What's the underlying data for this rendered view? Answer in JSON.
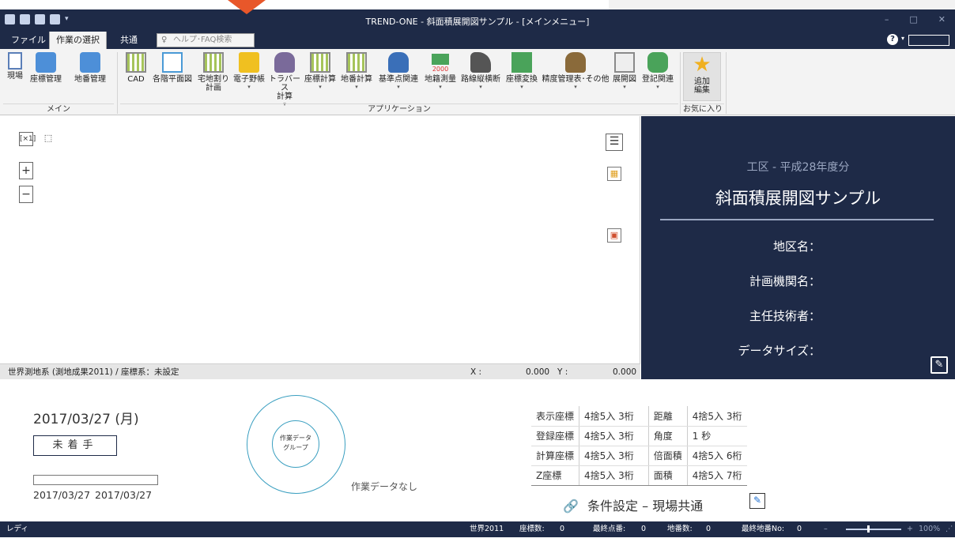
{
  "window": {
    "title": "TREND-ONE - 斜面積展開図サンプル - [メインメニュー]",
    "controls": [
      "–",
      "□",
      "✕"
    ]
  },
  "menu": {
    "tabs": [
      "ファイル",
      "作業の選択",
      "共通"
    ],
    "active_tab": "作業の選択",
    "help_search_placeholder": "ヘルプ･FAQ検索"
  },
  "ribbon": {
    "groups": [
      {
        "label": "メイン",
        "buttons": [
          {
            "label": "現場",
            "label2": "",
            "dropdown": false,
            "icon": "document-icon"
          },
          {
            "label": "座標管理",
            "label2": "",
            "dropdown": false,
            "icon": "coordinate-db-icon"
          },
          {
            "label": "地番管理",
            "label2": "",
            "dropdown": false,
            "icon": "lot-db-icon"
          }
        ]
      },
      {
        "label": "アプリケーション",
        "buttons": [
          {
            "label": "CAD",
            "label2": "",
            "dropdown": false,
            "icon": "cad-icon"
          },
          {
            "label": "各階平面図",
            "label2": "",
            "dropdown": false,
            "icon": "floor-plan-icon"
          },
          {
            "label": "宅地割り",
            "label2": "計画",
            "dropdown": false,
            "icon": "lot-plan-icon"
          },
          {
            "label": "電子野帳",
            "label2": "",
            "dropdown": true,
            "icon": "field-book-icon"
          },
          {
            "label": "トラバース",
            "label2": "計算",
            "dropdown": true,
            "icon": "traverse-icon"
          },
          {
            "label": "座標計算",
            "label2": "",
            "dropdown": true,
            "icon": "coordinate-calc-icon"
          },
          {
            "label": "地番計算",
            "label2": "",
            "dropdown": true,
            "icon": "lot-calc-icon"
          },
          {
            "label": "基準点関連",
            "label2": "",
            "dropdown": true,
            "icon": "control-point-icon"
          },
          {
            "label": "地籍測量",
            "label2": "",
            "dropdown": true,
            "icon": "cadastral-survey-icon"
          },
          {
            "label": "路線縦横断",
            "label2": "",
            "dropdown": true,
            "icon": "route-profile-icon"
          },
          {
            "label": "座標変換",
            "label2": "",
            "dropdown": true,
            "icon": "coordinate-transform-icon"
          },
          {
            "label": "精度管理表･その他",
            "label2": "",
            "dropdown": true,
            "icon": "accuracy-table-icon"
          },
          {
            "label": "展開図",
            "label2": "",
            "dropdown": true,
            "icon": "development-view-icon"
          },
          {
            "label": "登記関連",
            "label2": "",
            "dropdown": true,
            "icon": "registration-icon"
          }
        ]
      },
      {
        "label": "お気に入り",
        "buttons": [
          {
            "label": "追加",
            "label2": "編集",
            "dropdown": false,
            "icon": "star-icon"
          }
        ]
      }
    ],
    "icon_glyph_2000": "2000"
  },
  "canvas": {
    "tools": [
      "[×1]",
      "⬚",
      "+",
      "−"
    ],
    "side_tools": [
      "menu-icon",
      "layout-icon",
      "image-icon"
    ],
    "coord_system": "世界測地系 (測地成果2011) / 座標系：未設定",
    "x_label": "X :",
    "x_value": "0.000",
    "y_label": "Y :",
    "y_value": "0.000"
  },
  "project": {
    "subtitle": "工区 - 平成28年度分",
    "title": "斜面積展開図サンプル",
    "fields": [
      "地区名：",
      "計画機関名：",
      "主任技術者：",
      "データサイズ："
    ]
  },
  "info": {
    "date": "2017/03/27 (月)",
    "status": "未着手",
    "progress": 0,
    "start_date": "2017/03/27",
    "end_date": "2017/03/27",
    "circle_label": "作業データ\nグループ",
    "no_data": "作業データなし",
    "settings": [
      [
        "表示座標",
        "4捨5入 3桁",
        "距離",
        "4捨5入 3桁"
      ],
      [
        "登録座標",
        "4捨5入 3桁",
        "角度",
        "1 秒"
      ],
      [
        "計算座標",
        "4捨5入 3桁",
        "倍面積",
        "4捨5入 6桁"
      ],
      [
        "Z座標",
        "4捨5入 3桁",
        "面積",
        "4捨5入 7桁"
      ]
    ],
    "condition_link": "条件設定 – 現場共通"
  },
  "statusbar": {
    "ready": "レディ",
    "datum": "世界2011",
    "coord_count_label": "座標数:",
    "coord_count": "0",
    "last_point_label": "最終点番:",
    "last_point": "0",
    "lot_count_label": "地番数:",
    "lot_count": "0",
    "last_lot_label": "最終地番No:",
    "last_lot": "0",
    "zoom": "100%"
  },
  "colors": {
    "navy": "#1e2a47",
    "accent_arrow": "#e8572a",
    "circle": "#3a9fc0"
  }
}
